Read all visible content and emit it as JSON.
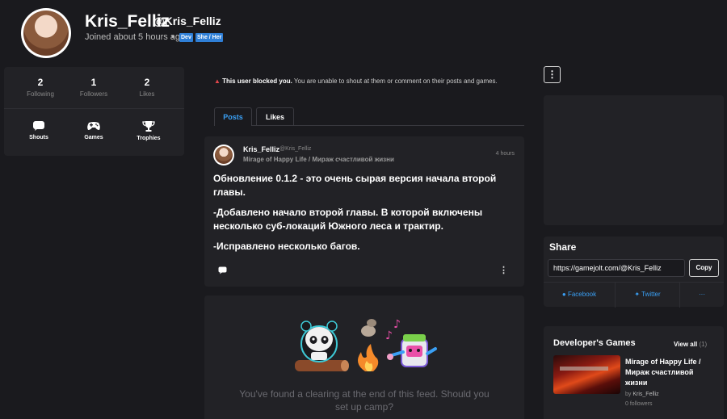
{
  "profile": {
    "username": "Kris_Felliz",
    "handle": "@Kris_Felliz",
    "joined": "Joined about 5 hours ago",
    "separator": "•",
    "tags": [
      "Dev",
      "She / Her"
    ]
  },
  "stats": [
    {
      "value": "2",
      "label": "Following"
    },
    {
      "value": "1",
      "label": "Followers"
    },
    {
      "value": "2",
      "label": "Likes"
    }
  ],
  "links": [
    {
      "label": "Shouts",
      "icon": "chat-bubble-icon"
    },
    {
      "label": "Games",
      "icon": "gamepad-icon"
    },
    {
      "label": "Trophies",
      "icon": "trophy-icon"
    }
  ],
  "notice": {
    "title": "This user blocked you.",
    "text": " You are unable to shout at them or comment on their posts and games."
  },
  "tabs": [
    {
      "label": "Posts",
      "active": true
    },
    {
      "label": "Likes",
      "active": false
    }
  ],
  "post": {
    "author": "Kris_Felliz",
    "handle": "@Kris_Felliz",
    "game": "Mirage of Happy Life / Мираж счастливой жизни",
    "time": "4 hours",
    "paragraphs": [
      "Обновление 0.1.2 - это очень сырая версия начала второй главы.",
      "-Добавлено начало второй главы. В которой включены несколько суб-локаций Южного леса и трактир.",
      "-Исправлено несколько багов."
    ],
    "more": "⋮"
  },
  "feed_end": {
    "message": "You've found a clearing at the end of this feed. Should you set up camp?"
  },
  "right": {
    "more": "⋮",
    "share": {
      "title": "Share",
      "url": "https://gamejolt.com/@Kris_Felliz",
      "copy_label": "Copy",
      "options": [
        "Facebook",
        "Twitter",
        "···"
      ]
    },
    "dev_games": {
      "title": "Developer's Games",
      "view_all": "View all",
      "count": "(1)",
      "game_name": "Mirage of Happy Life / Мираж счастливой жизни",
      "by_label": "by",
      "by_author": "Kris_Felliz",
      "followers": "0 followers"
    }
  },
  "colors": {
    "accent": "#3aa0f5",
    "tag": "#2f7fd7",
    "warning": "#e0464b",
    "panel": "#222226",
    "background": "#1a1a1e"
  }
}
